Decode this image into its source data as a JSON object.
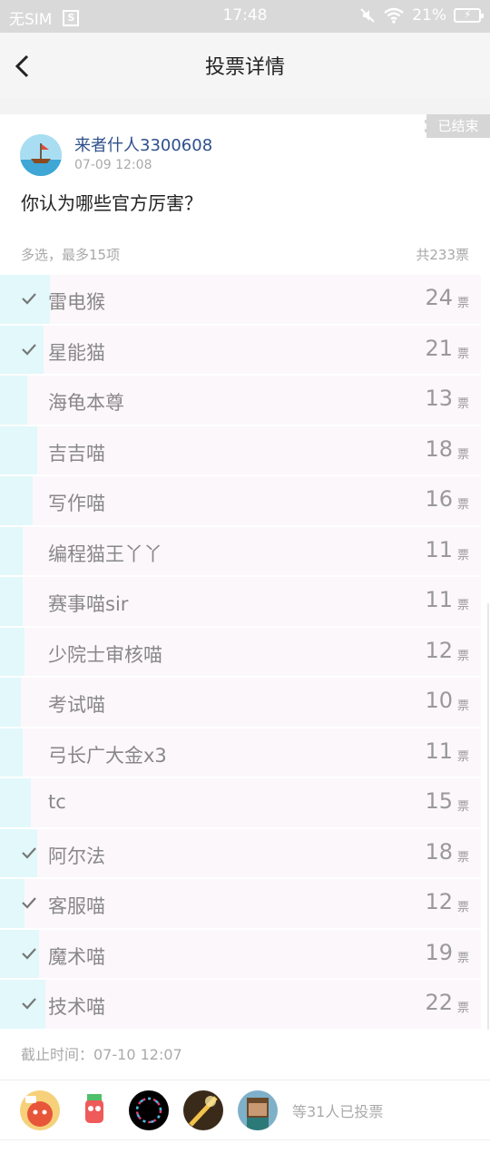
{
  "status_bar": {
    "carrier": "无SIM",
    "sim_glyph": "S",
    "time": "17:48",
    "battery": "21%",
    "bolt": "⚡"
  },
  "header": {
    "title": "投票详情"
  },
  "poll": {
    "status": "已结束",
    "author_name": "来者什人3300608",
    "author_time": "07-09 12:08",
    "question": "你认为哪些官方厉害？",
    "mode": "多选，最多15项",
    "total": "共233票",
    "deadline": "截止时间：07-10 12:07",
    "voters_text": "等31人已投票",
    "vote_unit": "票",
    "options": [
      {
        "label": "雷电猴",
        "count": "24",
        "votes": 24,
        "checked": true
      },
      {
        "label": "星能猫",
        "count": "21",
        "votes": 21,
        "checked": true
      },
      {
        "label": "海龟本尊",
        "count": "13",
        "votes": 13,
        "checked": false
      },
      {
        "label": "吉吉喵",
        "count": "18",
        "votes": 18,
        "checked": false
      },
      {
        "label": "写作喵",
        "count": "16",
        "votes": 16,
        "checked": false
      },
      {
        "label": "编程猫王丫丫",
        "count": "11",
        "votes": 11,
        "checked": false
      },
      {
        "label": "赛事喵sir",
        "count": "11",
        "votes": 11,
        "checked": false
      },
      {
        "label": "少院士审核喵",
        "count": "12",
        "votes": 12,
        "checked": false
      },
      {
        "label": "考试喵",
        "count": "10",
        "votes": 10,
        "checked": false
      },
      {
        "label": "弓长广大金x3",
        "count": "11",
        "votes": 11,
        "checked": false
      },
      {
        "label": "tc",
        "count": "15",
        "votes": 15,
        "checked": false
      },
      {
        "label": "阿尔法",
        "count": "18",
        "votes": 18,
        "checked": true
      },
      {
        "label": "客服喵",
        "count": "12",
        "votes": 12,
        "checked": true
      },
      {
        "label": "魔术喵",
        "count": "19",
        "votes": 19,
        "checked": true
      },
      {
        "label": "技术喵",
        "count": "22",
        "votes": 22,
        "checked": true
      }
    ]
  },
  "colors": {
    "fill": "#e2f8fb",
    "option_bg": "#fcf7fb",
    "author_name": "#2d4f8b"
  }
}
